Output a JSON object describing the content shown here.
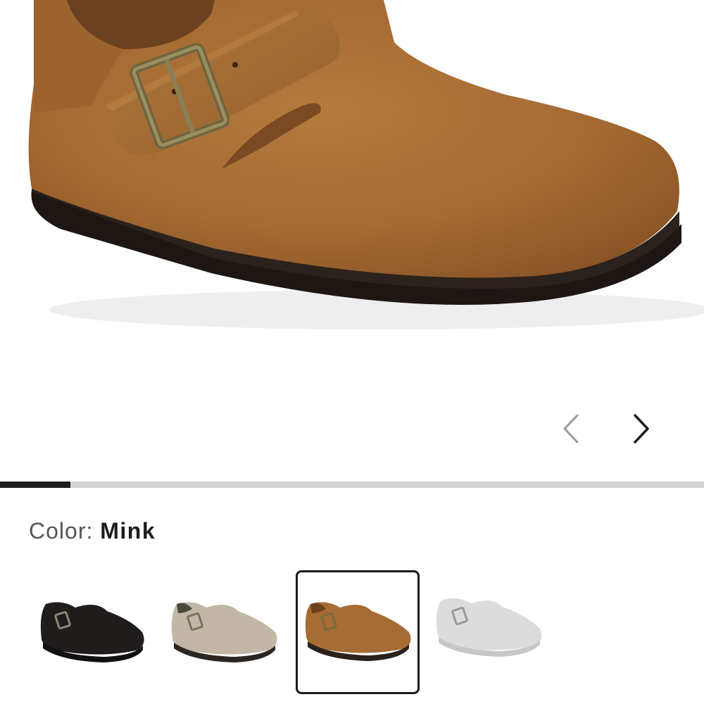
{
  "gallery": {
    "product_image_icon": "shoe-suede-clog-icon",
    "prev_icon": "chevron-left-icon",
    "next_icon": "chevron-right-icon",
    "progress_fraction": 0.1,
    "progress_color": "#1e1e1e",
    "track_color": "#d4d4d4"
  },
  "color_selector": {
    "label": "Color:",
    "selected": "Mink",
    "swatches": [
      {
        "id": "black",
        "hex": "#1f1c1b",
        "selected": false
      },
      {
        "id": "taupe",
        "hex": "#c2b7a6",
        "selected": false
      },
      {
        "id": "mink",
        "hex": "#a66c34",
        "selected": true
      },
      {
        "id": "grey",
        "hex": "#dcdcdc",
        "selected": false
      }
    ]
  }
}
